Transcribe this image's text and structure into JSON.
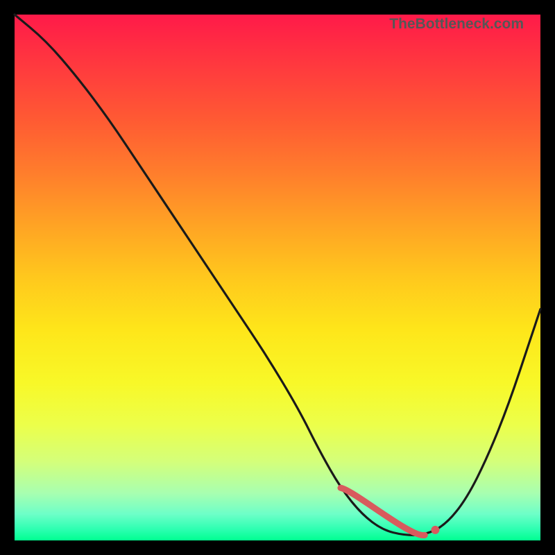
{
  "watermark": "TheBottleneck.com",
  "colors": {
    "background": "#000000",
    "curve": "#1a1a1a",
    "marker": "#d85a5d",
    "gradient_top": "#ff1a49",
    "gradient_bottom": "#00ff90"
  },
  "chart_data": {
    "type": "line",
    "title": "",
    "xlabel": "",
    "ylabel": "",
    "ylim": [
      0,
      100
    ],
    "xlim": [
      0,
      100
    ],
    "series": [
      {
        "name": "bottleneck-curve",
        "x": [
          0,
          6,
          12,
          18,
          24,
          30,
          36,
          42,
          48,
          54,
          58,
          62,
          66,
          70,
          74,
          78,
          82,
          86,
          90,
          94,
          98,
          100
        ],
        "values": [
          100,
          95,
          88,
          80,
          71,
          62,
          53,
          44,
          35,
          25,
          17,
          10,
          5,
          2,
          1,
          1,
          3,
          8,
          16,
          26,
          38,
          44
        ]
      }
    ],
    "markers": {
      "flat_region_start_x": 62,
      "flat_region_end_x": 78,
      "dot_x": 80,
      "dot_y": 2
    },
    "background": "vertical-gradient-red-to-green"
  }
}
